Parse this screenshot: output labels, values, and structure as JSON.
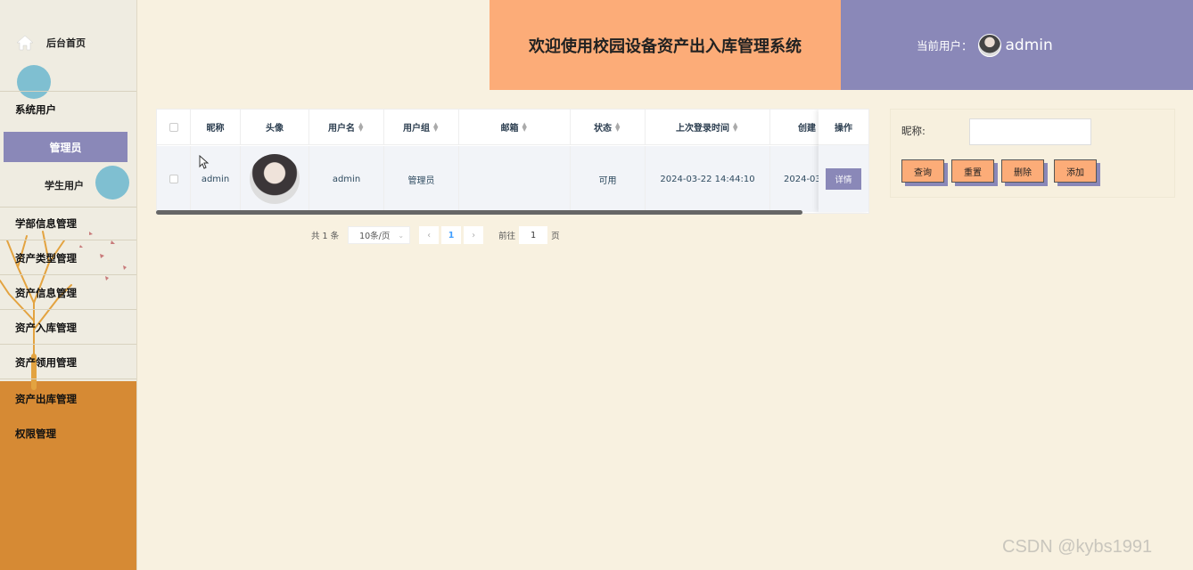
{
  "sidebar": {
    "home_label": "后台首页",
    "system_user": "系统用户",
    "sub_admin": "管理员",
    "sub_student": "学生用户",
    "items": [
      "学部信息管理",
      "资产类型管理",
      "资产信息管理",
      "资产入库管理",
      "资产领用管理",
      "资产出库管理",
      "权限管理"
    ]
  },
  "header": {
    "title": "欢迎使用校园设备资产出入库管理系统",
    "current_user_label": "当前用户：",
    "username": "admin"
  },
  "table": {
    "columns": [
      "昵称",
      "头像",
      "用户名",
      "用户组",
      "邮箱",
      "状态",
      "上次登录时间",
      "创建"
    ],
    "op_header": "操作",
    "rows": [
      {
        "nickname": "admin",
        "username": "admin",
        "group": "管理员",
        "email": "",
        "status": "可用",
        "last_login": "2024-03-22 14:44:10",
        "created": "2024-03",
        "action": "详情"
      }
    ]
  },
  "pager": {
    "total": "共 1 条",
    "page_size": "10条/页",
    "current_page": "1",
    "goto_label": "前往",
    "goto_value": "1",
    "page_suffix": "页"
  },
  "search": {
    "label": "昵称:",
    "value": "",
    "buttons": [
      "查询",
      "重置",
      "删除",
      "添加"
    ]
  },
  "watermark": "CSDN @kybs1991",
  "colors": {
    "accent_purple": "#8a88b8",
    "accent_orange": "#fcac78",
    "sidebar_orange": "#d68a34",
    "page_bg": "#f8f1e0"
  }
}
